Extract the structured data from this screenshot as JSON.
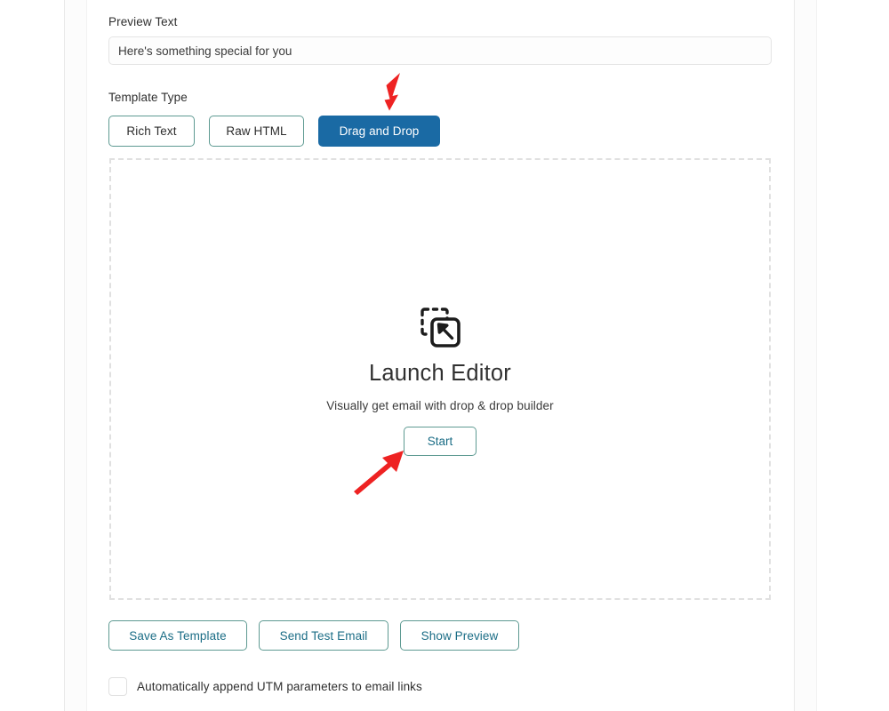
{
  "theme": {
    "accent_blue": "#1a6aa4",
    "accent_teal": "#5e9a92",
    "link_teal": "#1b6d86",
    "annotation_red": "#ee2222",
    "border_gray": "#e0e0e0"
  },
  "form": {
    "preview_text": {
      "label": "Preview Text",
      "value": "Here's something special for you",
      "placeholder": "Preview Text"
    },
    "template_type": {
      "label": "Template Type",
      "options": [
        {
          "label": "Rich Text",
          "selected": false
        },
        {
          "label": "Raw HTML",
          "selected": false
        },
        {
          "label": "Drag and Drop",
          "selected": true
        }
      ]
    }
  },
  "drop_area": {
    "icon": "drag-and-drop-cursor-icon",
    "title": "Launch Editor",
    "subtitle": "Visually get email with drop & drop builder",
    "start_label": "Start"
  },
  "actions": {
    "save_as_template": "Save As Template",
    "send_test_email": "Send Test Email",
    "show_preview": "Show Preview"
  },
  "utm": {
    "label": "Automatically append UTM parameters to email links",
    "checked": false
  },
  "annotations": [
    {
      "name": "arrow-to-drag-drop",
      "direction": "down-left",
      "target": "Drag and Drop"
    },
    {
      "name": "arrow-to-start",
      "direction": "up-right",
      "target": "Start"
    }
  ]
}
